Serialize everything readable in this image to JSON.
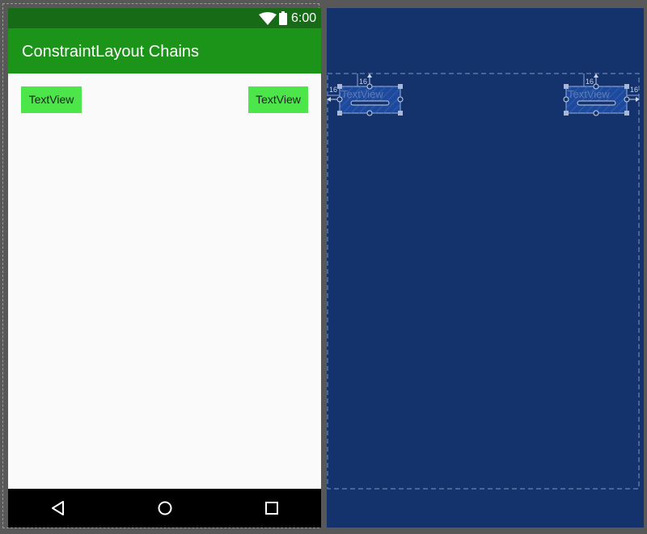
{
  "status_bar": {
    "time": "6:00",
    "icons": [
      "wifi-icon",
      "battery-icon"
    ]
  },
  "app_bar": {
    "title": "ConstraintLayout Chains",
    "color": "#1c9419"
  },
  "content": {
    "textviews": [
      {
        "label": "TextView",
        "color": "#4ce64a"
      },
      {
        "label": "TextView",
        "color": "#4ce64a"
      }
    ]
  },
  "nav_bar": {
    "icons": [
      "back-icon",
      "home-icon",
      "recents-icon"
    ]
  },
  "blueprint": {
    "background": "#14326c",
    "textviews": [
      {
        "label": "TextView",
        "margin_top": "16",
        "margin_side": "16"
      },
      {
        "label": "TextView",
        "margin_top": "16",
        "margin_side": "16"
      }
    ]
  }
}
